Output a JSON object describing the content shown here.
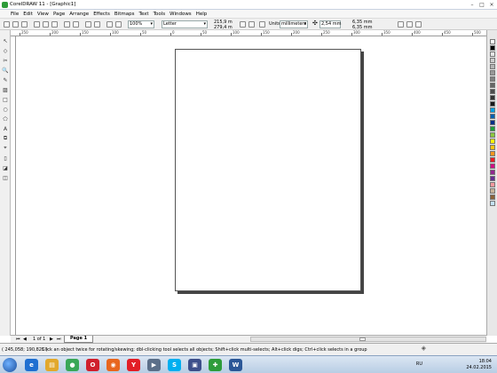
{
  "window": {
    "title": "CorelDRAW 11 - [Graphic1]",
    "min": "–",
    "max": "□",
    "close": "×"
  },
  "menu": [
    "File",
    "Edit",
    "View",
    "Page",
    "Arrange",
    "Effects",
    "Bitmaps",
    "Text",
    "Tools",
    "Windows",
    "Help"
  ],
  "toolbar": {
    "zoom": "100%",
    "paper_size": "Letter",
    "width": "215,9 m",
    "height": "279,4 m",
    "units_label": "Units:",
    "units_value": "millimeters",
    "nudge": "2,54 mm",
    "dup_x": "6,35 mm",
    "dup_y": "6,35 mm"
  },
  "ruler_labels": [
    "250",
    "200",
    "150",
    "100",
    "50",
    "0",
    "50",
    "100",
    "150",
    "200",
    "250",
    "300",
    "350",
    "400",
    "450",
    "500"
  ],
  "tools": [
    "pick-tool",
    "shape-tool",
    "knife-tool",
    "zoom-tool",
    "freehand-tool",
    "smart-fill-tool",
    "rectangle-tool",
    "ellipse-tool",
    "polygon-tool",
    "text-tool",
    "interactive-blend-tool",
    "eyedropper-tool",
    "outline-tool",
    "fill-tool",
    "interactive-fill-tool"
  ],
  "palette_colors": [
    "#ffffff",
    "#000000",
    "#e6e6e6",
    "#cccccc",
    "#b3b3b3",
    "#999999",
    "#808080",
    "#666666",
    "#4d4d4d",
    "#333333",
    "#1a1a1a",
    "#00a0e3",
    "#0060b0",
    "#002f87",
    "#1e9c3a",
    "#8cc63f",
    "#fff200",
    "#ffc20e",
    "#f7941d",
    "#ed1c24",
    "#d10f82",
    "#92278f",
    "#662d91",
    "#f5989d",
    "#c7b299",
    "#8c6239",
    "#c2e0f4"
  ],
  "pagebar": {
    "first": "⏮",
    "prev": "◀",
    "page_count": "1 of 1",
    "next": "▶",
    "last": "⏭",
    "tab": "Page 1"
  },
  "status": {
    "coords": "( 245,058; 190,825 )",
    "hint": "Click an object twice for rotating/skewing; dbl-clicking tool selects all objects; Shift+click multi-selects; Alt+click digs; Ctrl+click selects in a group"
  },
  "taskbar": {
    "apps": [
      {
        "name": "ie",
        "glyph": "e",
        "color": "#1f6fd1"
      },
      {
        "name": "folder",
        "glyph": "▤",
        "color": "#e2a82c"
      },
      {
        "name": "chrome",
        "glyph": "●",
        "color": "#3aa757"
      },
      {
        "name": "opera",
        "glyph": "O",
        "color": "#d0202d"
      },
      {
        "name": "firefox",
        "glyph": "◉",
        "color": "#e8661e"
      },
      {
        "name": "yandex",
        "glyph": "Y",
        "color": "#e21e26"
      },
      {
        "name": "media",
        "glyph": "▶",
        "color": "#5b6f89"
      },
      {
        "name": "skype",
        "glyph": "S",
        "color": "#00aff0"
      },
      {
        "name": "save",
        "glyph": "▣",
        "color": "#3d4f8a"
      },
      {
        "name": "corel",
        "glyph": "✚",
        "color": "#2e9c3a"
      },
      {
        "name": "word",
        "glyph": "W",
        "color": "#2b5797"
      }
    ],
    "lang": "RU",
    "time": "18:04",
    "date": "24.02.2015"
  }
}
